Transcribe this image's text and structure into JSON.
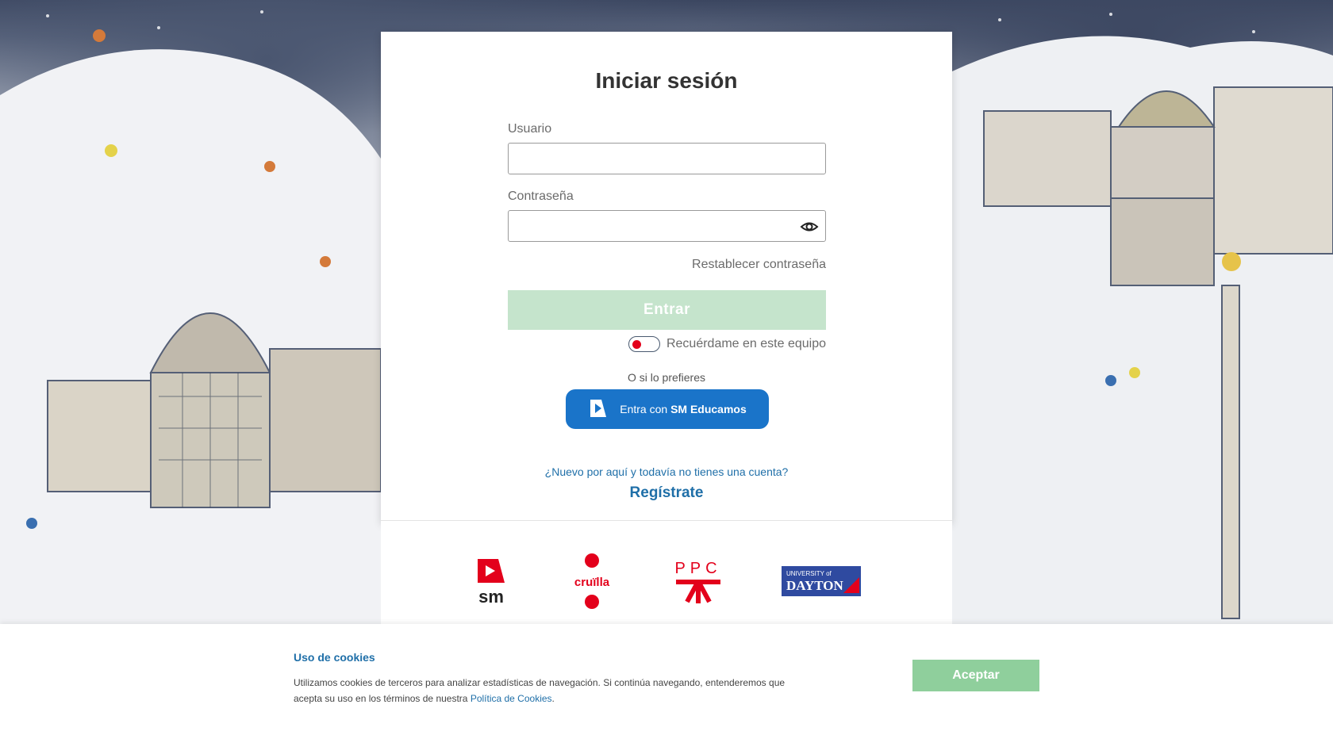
{
  "login": {
    "title": "Iniciar sesión",
    "username_label": "Usuario",
    "username_value": "",
    "password_label": "Contraseña",
    "password_value": "",
    "reset_password": "Restablecer contraseña",
    "submit": "Entrar",
    "remember_me": "Recuérdame en este equipo",
    "remember_me_checked": false,
    "or_text": "O si lo prefieres",
    "sso_prefix": "Entra con",
    "sso_brand": "SM Educamos",
    "new_question": "¿Nuevo por aquí y todavía no tienes una cuenta?",
    "register": "Regístrate"
  },
  "logos": {
    "sm": "sm",
    "cruilla": "cruïlla",
    "ppc": "PPC",
    "dayton_line1": "UNIVERSITY of",
    "dayton_line2": "DAYTON"
  },
  "cookies": {
    "title": "Uso de cookies",
    "text": "Utilizamos cookies de terceros para analizar estadísticas de navegación. Si continúa navegando, entenderemos que acepta su uso en los términos de nuestra",
    "policy_link": "Política de Cookies",
    "accept": "Aceptar"
  },
  "colors": {
    "primary_blue": "#1a74c9",
    "link_blue": "#1f6fa8",
    "enter_disabled": "#c5e4cc",
    "accept_green": "#8fcf9c",
    "sm_red": "#e3001b"
  },
  "icons": {
    "eye": "eye-icon",
    "sso": "sm-educamos-logo-icon"
  }
}
